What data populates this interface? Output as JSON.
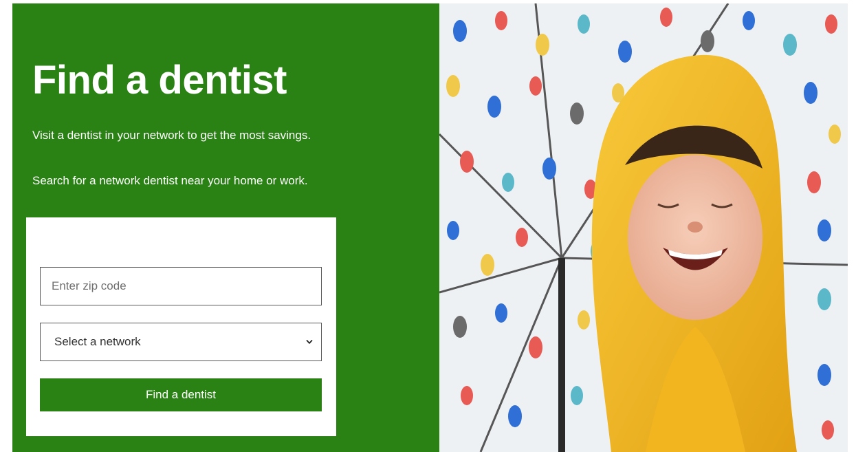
{
  "hero": {
    "title": "Find a dentist",
    "subtitle_1": "Visit a dentist in your network to get the most savings.",
    "subtitle_2": "Search for a network dentist near your home or work."
  },
  "form": {
    "zip_placeholder": "Enter zip code",
    "network_select": "Select a network",
    "submit_label": "Find a dentist"
  },
  "colors": {
    "brand_green": "#2a8114",
    "raincoat_yellow": "#f2b51f"
  },
  "icons": {
    "select_caret": "chevron-down-icon"
  }
}
